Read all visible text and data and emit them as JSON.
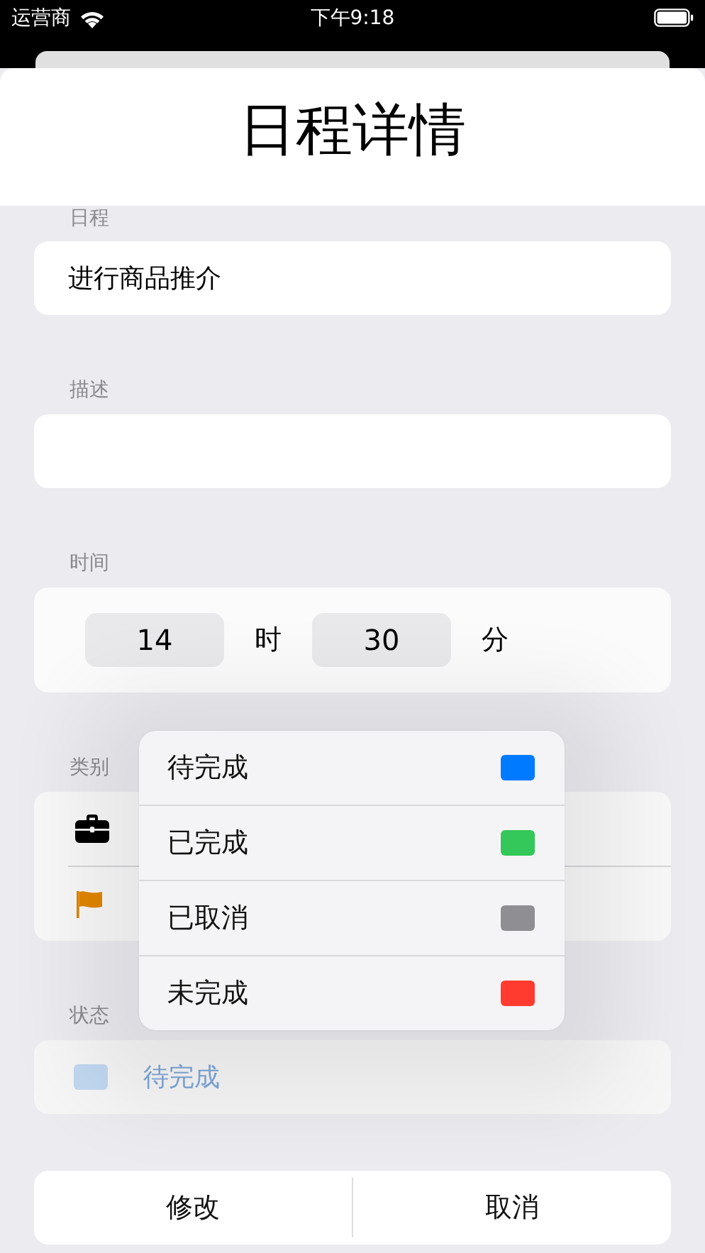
{
  "status_bar": {
    "carrier": "运营商",
    "time": "下午9:18"
  },
  "sheet": {
    "title": "日程详情"
  },
  "form": {
    "schedule": {
      "label": "日程",
      "value": "进行商品推介"
    },
    "description": {
      "label": "描述"
    },
    "time": {
      "label": "时间",
      "hour": "14",
      "hour_unit": "时",
      "minute": "30",
      "minute_unit": "分"
    },
    "category": {
      "label": "类别",
      "options": [
        {
          "kind": "briefcase"
        },
        {
          "kind": "flag"
        }
      ]
    },
    "status": {
      "label": "状态",
      "value": "待完成",
      "color": "#c2d8f1"
    }
  },
  "buttons": [
    {
      "label": "修改"
    },
    {
      "label": "取消"
    }
  ],
  "status_menu": {
    "items": [
      {
        "label": "待完成",
        "color": "#007aff"
      },
      {
        "label": "已完成",
        "color": "#34c759"
      },
      {
        "label": "已取消",
        "color": "#8e8e93"
      },
      {
        "label": "未完成",
        "color": "#ff3b30"
      }
    ]
  }
}
